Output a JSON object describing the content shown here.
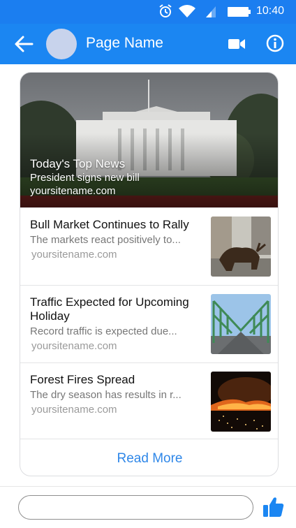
{
  "status_bar": {
    "time": "10:40"
  },
  "header": {
    "page_name": "Page Name"
  },
  "hero": {
    "title": "Today's Top News",
    "subtitle": "President signs new bill",
    "domain": "yoursitename.com"
  },
  "items": [
    {
      "title": "Bull Market Continues to Rally",
      "subtitle": "The markets react positively to...",
      "domain": "yoursitename.com"
    },
    {
      "title": "Traffic Expected for Upcoming Holiday",
      "subtitle": "Record traffic is expected due...",
      "domain": "yoursitename.com"
    },
    {
      "title": "Forest Fires Spread",
      "subtitle": "The dry season has results in r...",
      "domain": "yoursitename.com"
    }
  ],
  "read_more": "Read More",
  "compose": {
    "value": "",
    "placeholder": ""
  },
  "colors": {
    "brand": "#1b86f2",
    "link": "#2f87e8"
  }
}
